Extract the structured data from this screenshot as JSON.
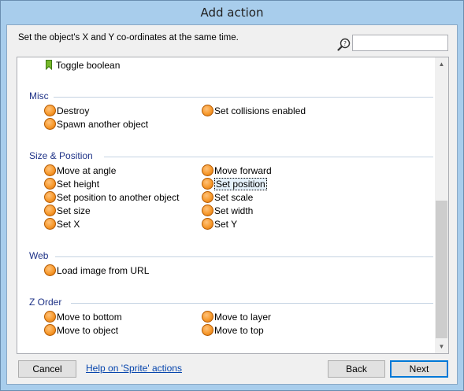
{
  "window": {
    "title": "Add action"
  },
  "description": "Set the object's X and Y co-ordinates at the same time.",
  "search": {
    "value": "",
    "placeholder": ""
  },
  "top_item": {
    "label": "Toggle boolean",
    "icon": "green-bookmark-icon"
  },
  "sections": [
    {
      "title": "Misc",
      "items": [
        {
          "label": "Destroy"
        },
        {
          "label": "Set collisions enabled"
        },
        {
          "label": "Spawn another object"
        }
      ]
    },
    {
      "title": "Size & Position",
      "items": [
        {
          "label": "Move at angle"
        },
        {
          "label": "Move forward"
        },
        {
          "label": "Set height"
        },
        {
          "label": "Set position"
        },
        {
          "label": "Set position to another object"
        },
        {
          "label": "Set scale"
        },
        {
          "label": "Set size"
        },
        {
          "label": "Set width"
        },
        {
          "label": "Set X"
        },
        {
          "label": "Set Y"
        }
      ]
    },
    {
      "title": "Web",
      "items": [
        {
          "label": "Load image from URL"
        }
      ]
    },
    {
      "title": "Z Order",
      "items": [
        {
          "label": "Move to bottom"
        },
        {
          "label": "Move to layer"
        },
        {
          "label": "Move to object"
        },
        {
          "label": "Move to top"
        }
      ]
    }
  ],
  "selected_item": "Set position",
  "buttons": {
    "cancel": "Cancel",
    "help": "Help on 'Sprite' actions",
    "back": "Back",
    "next": "Next"
  },
  "colors": {
    "section_title": "#1e3287",
    "action_icon": "#f79a2e",
    "window_frame": "#a8cdec"
  }
}
